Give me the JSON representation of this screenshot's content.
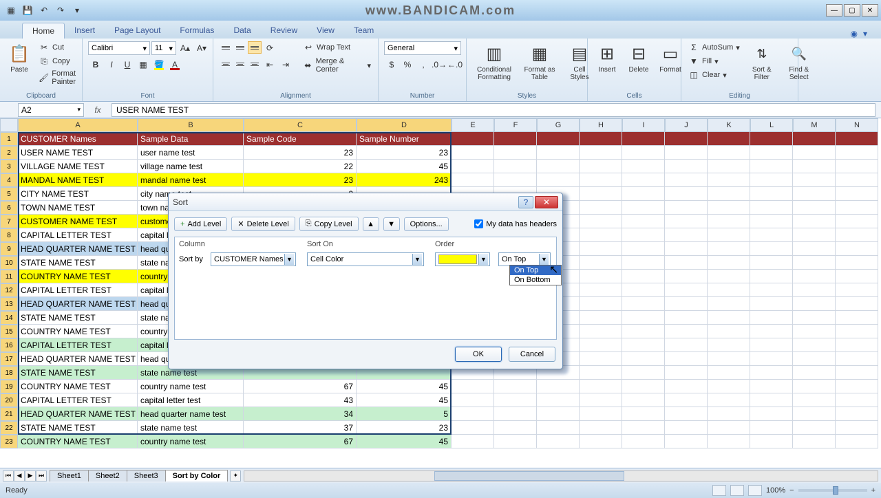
{
  "app": {
    "watermark": "www.BANDICAM.com",
    "name_box": "A2",
    "formula_value": "USER NAME TEST",
    "status": "Ready",
    "zoom": "100%"
  },
  "tabs": {
    "items": [
      "Home",
      "Insert",
      "Page Layout",
      "Formulas",
      "Data",
      "Review",
      "View",
      "Team"
    ],
    "active": 0
  },
  "ribbon": {
    "clipboard": {
      "label": "Clipboard",
      "cut": "Cut",
      "copy": "Copy",
      "format_painter": "Format Painter",
      "paste": "Paste"
    },
    "font": {
      "label": "Font",
      "name": "Calibri",
      "size": "11"
    },
    "alignment": {
      "label": "Alignment",
      "wrap": "Wrap Text",
      "merge": "Merge & Center"
    },
    "number": {
      "label": "Number",
      "format": "General"
    },
    "styles": {
      "label": "Styles",
      "cond": "Conditional Formatting",
      "table": "Format as Table",
      "cell": "Cell Styles"
    },
    "cells": {
      "label": "Cells",
      "insert": "Insert",
      "delete": "Delete",
      "format": "Format"
    },
    "editing": {
      "label": "Editing",
      "autosum": "AutoSum",
      "fill": "Fill",
      "clear": "Clear",
      "sort": "Sort & Filter",
      "find": "Find & Select"
    }
  },
  "columns": {
    "letters": [
      "A",
      "B",
      "C",
      "D",
      "E",
      "F",
      "G",
      "H",
      "I",
      "J",
      "K",
      "L",
      "M",
      "N"
    ],
    "widths": [
      174,
      154,
      164,
      138,
      62,
      62,
      62,
      62,
      62,
      62,
      62,
      62,
      62,
      62
    ],
    "selected": [
      0,
      1,
      2,
      3
    ]
  },
  "headers": [
    "CUSTOMER Names",
    "Sample Data",
    "Sample Code",
    "Sample Number"
  ],
  "rows": [
    {
      "bg": "#ffffff",
      "a": "USER NAME TEST",
      "b": "user name test",
      "c": "23",
      "d": "23"
    },
    {
      "bg": "#ffffff",
      "a": "VILLAGE NAME TEST",
      "b": "village name test",
      "c": "22",
      "d": "45"
    },
    {
      "bg": "#ffff00",
      "a": "MANDAL NAME TEST",
      "b": "mandal name test",
      "c": "23",
      "d": "243"
    },
    {
      "bg": "#ffffff",
      "a": "CITY NAME TEST",
      "b": "city name test",
      "c": "2",
      "d": ""
    },
    {
      "bg": "#ffffff",
      "a": "TOWN NAME TEST",
      "b": "town name test",
      "c": "",
      "d": ""
    },
    {
      "bg": "#ffff00",
      "a": "CUSTOMER NAME TEST",
      "b": "customer name test",
      "c": "",
      "d": ""
    },
    {
      "bg": "#ffffff",
      "a": "CAPITAL LETTER TEST",
      "b": "capital letter test",
      "c": "",
      "d": ""
    },
    {
      "bg": "#bdd7ee",
      "a": "HEAD QUARTER NAME TEST",
      "b": "head quarter name test",
      "c": "",
      "d": ""
    },
    {
      "bg": "#ffffff",
      "a": "STATE NAME TEST",
      "b": "state name test",
      "c": "",
      "d": ""
    },
    {
      "bg": "#ffff00",
      "a": "COUNTRY NAME TEST",
      "b": "country name test",
      "c": "",
      "d": ""
    },
    {
      "bg": "#ffffff",
      "a": "CAPITAL LETTER TEST",
      "b": "capital letter test",
      "c": "",
      "d": ""
    },
    {
      "bg": "#bdd7ee",
      "a": "HEAD QUARTER NAME TEST",
      "b": "head quarter name test",
      "c": "",
      "d": ""
    },
    {
      "bg": "#ffffff",
      "a": "STATE NAME TEST",
      "b": "state name test",
      "c": "",
      "d": ""
    },
    {
      "bg": "#ffffff",
      "a": "COUNTRY NAME TEST",
      "b": "country name test",
      "c": "",
      "d": ""
    },
    {
      "bg": "#c6efce",
      "a": "CAPITAL LETTER TEST",
      "b": "capital letter test",
      "c": "",
      "d": ""
    },
    {
      "bg": "#ffffff",
      "a": "HEAD QUARTER NAME TEST",
      "b": "head quarter name test",
      "c": "",
      "d": ""
    },
    {
      "bg": "#c6efce",
      "a": "STATE NAME TEST",
      "b": "state name test",
      "c": "",
      "d": ""
    },
    {
      "bg": "#ffffff",
      "a": "COUNTRY NAME TEST",
      "b": "country name test",
      "c": "67",
      "d": "45"
    },
    {
      "bg": "#ffffff",
      "a": "CAPITAL LETTER TEST",
      "b": "capital letter test",
      "c": "43",
      "d": "45"
    },
    {
      "bg": "#c6efce",
      "a": "HEAD QUARTER NAME TEST",
      "b": "head quarter name test",
      "c": "34",
      "d": "5"
    },
    {
      "bg": "#ffffff",
      "a": "STATE NAME TEST",
      "b": "state name test",
      "c": "37",
      "d": "23"
    },
    {
      "bg": "#c6efce",
      "a": "COUNTRY NAME TEST",
      "b": "country name test",
      "c": "67",
      "d": "45"
    }
  ],
  "sheets": {
    "items": [
      "Sheet1",
      "Sheet2",
      "Sheet3",
      "Sort by Color"
    ],
    "active": 3
  },
  "dialog": {
    "title": "Sort",
    "add_level": "Add Level",
    "delete_level": "Delete Level",
    "copy_level": "Copy Level",
    "options": "Options...",
    "headers_chk": "My data has headers",
    "col_header": "Column",
    "sorton_header": "Sort On",
    "order_header": "Order",
    "sortby_label": "Sort by",
    "column_value": "CUSTOMER Names",
    "sorton_value": "Cell Color",
    "color_value": "#ffff00",
    "order_value": "On Top",
    "order_options": [
      "On Top",
      "On Bottom"
    ],
    "ok": "OK",
    "cancel": "Cancel"
  }
}
